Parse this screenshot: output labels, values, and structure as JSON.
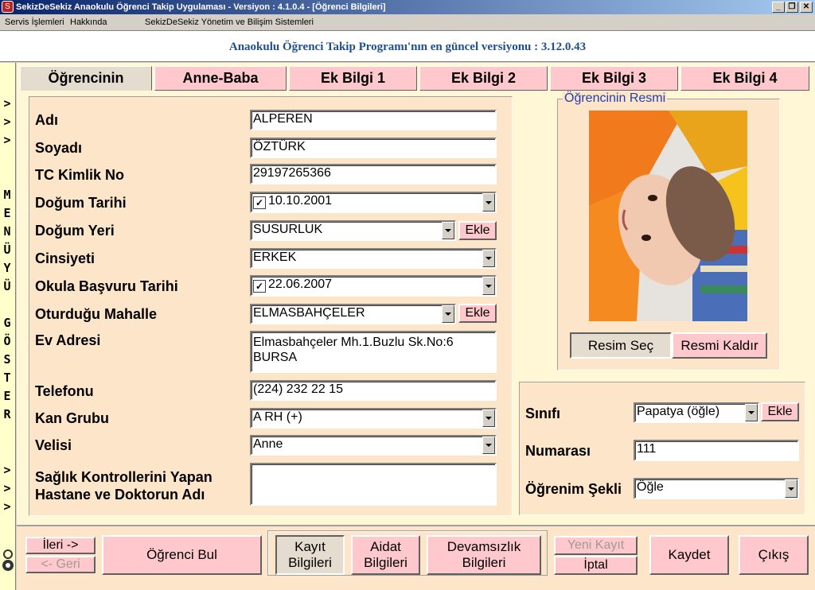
{
  "window": {
    "title": "SekizDeSekiz Anaokulu Öğrenci Takip Uygulaması - Versiyon : 4.1.0.4 - [Öğrenci Bilgileri]"
  },
  "menu": {
    "items": [
      "Servis İşlemleri",
      "Hakkında",
      "SekizDeSekiz Yönetim ve Bilişim Sistemleri"
    ]
  },
  "banner": {
    "text": "Anaokulu Öğrenci Takip Programı'nın en güncel versiyonu : 3.12.0.43"
  },
  "side_menu": {
    "arrows_top": [
      ">",
      ">",
      ">"
    ],
    "label": [
      "M",
      "E",
      "N",
      "Ü",
      "Y",
      "Ü",
      "",
      "G",
      "Ö",
      "S",
      "T",
      "E",
      "R"
    ],
    "arrows_bottom": [
      ">",
      ">",
      ">"
    ]
  },
  "tabs": [
    "Öğrencinin",
    "Anne-Baba",
    "Ek Bilgi 1",
    "Ek Bilgi 2",
    "Ek Bilgi 3",
    "Ek Bilgi 4"
  ],
  "form": {
    "adi": {
      "label": "Adı",
      "value": "ALPEREN"
    },
    "soyadi": {
      "label": "Soyadı",
      "value": "ÖZTÜRK"
    },
    "tc": {
      "label": "TC Kimlik No",
      "value": "29197265366"
    },
    "dogum_tarihi": {
      "label": "Doğum Tarihi",
      "value": "10.10.2001"
    },
    "dogum_yeri": {
      "label": "Doğum Yeri",
      "value": "SUSURLUK"
    },
    "cinsiyet": {
      "label": "Cinsiyeti",
      "value": "ERKEK"
    },
    "basvuru": {
      "label": "Okula Başvuru Tarihi",
      "value": "22.06.2007"
    },
    "mahalle": {
      "label": "Oturduğu Mahalle",
      "value": "ELMASBAHÇELER"
    },
    "adres": {
      "label": "Ev Adresi",
      "line1": "Elmasbahçeler Mh.1.Buzlu Sk.No:6",
      "line2": "BURSA"
    },
    "telefon": {
      "label": "Telefonu",
      "value": "(224) 232 22 15"
    },
    "kan": {
      "label": "Kan Grubu",
      "value": "A RH (+)"
    },
    "veli": {
      "label": "Velisi",
      "value": "Anne"
    },
    "saglik": {
      "label_line1": "Sağlık Kontrollerini Yapan",
      "label_line2": "Hastane ve Doktorun Adı",
      "value": ""
    },
    "ekle": "Ekle"
  },
  "photo": {
    "group_title": "Öğrencinin Resmi",
    "select_button": "Resim Seç",
    "remove_button": "Resmi Kaldır"
  },
  "class_panel": {
    "sinif": {
      "label": "Sınıfı",
      "value": "Papatya (öğle)"
    },
    "numara": {
      "label": "Numarası",
      "value": "111"
    },
    "ogrenim": {
      "label": "Öğrenim Şekli",
      "value": "Öğle"
    },
    "ekle": "Ekle"
  },
  "bottom": {
    "ileri": "İleri ->",
    "geri": "<- Geri",
    "ogrenci_bul": "Öğrenci Bul",
    "kayit_1": "Kayıt",
    "kayit_2": "Bilgileri",
    "aidat_1": "Aidat",
    "aidat_2": "Bilgileri",
    "devam_1": "Devamsızlık",
    "devam_2": "Bilgileri",
    "yeni_kayit": "Yeni Kayıt",
    "iptal": "İptal",
    "kaydet": "Kaydet",
    "cikis": "Çıkış"
  },
  "colors": {
    "tab_pink": "#ffc8cc",
    "panel_peach": "#fde5c9",
    "banner_text": "#1f4f8f",
    "strip_yellow": "#ffffcc"
  }
}
